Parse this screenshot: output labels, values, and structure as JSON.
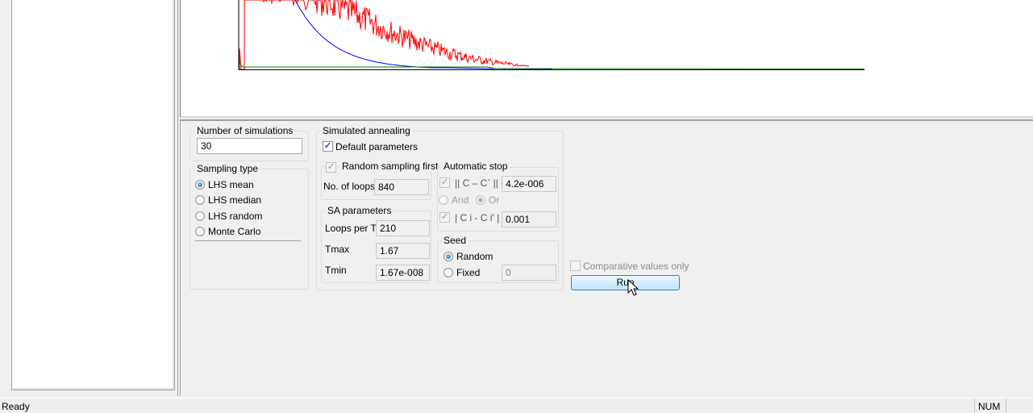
{
  "number_of_simulations": {
    "label": "Number of simulations",
    "value": "30"
  },
  "sampling_type": {
    "label": "Sampling type",
    "options": [
      {
        "label": "LHS mean",
        "selected": true
      },
      {
        "label": "LHS median",
        "selected": false
      },
      {
        "label": "LHS random",
        "selected": false
      },
      {
        "label": "Monte Carlo",
        "selected": false
      }
    ]
  },
  "simulated_annealing": {
    "label": "Simulated annealing",
    "default_parameters": {
      "label": "Default parameters",
      "checked": true
    },
    "random_sampling": {
      "label": "Random sampling first",
      "checked": true,
      "enabled": false,
      "loops_label": "No. of loops",
      "loops_value": "840"
    },
    "sa_parameters": {
      "label": "SA parameters",
      "loops_per_t_label": "Loops per T",
      "loops_per_t": "210",
      "tmax_label": "Tmax",
      "tmax": "1.67",
      "tmin_label": "Tmin",
      "tmin": "1.67e-008"
    },
    "automatic_stop": {
      "label": "Automatic stop",
      "c1_label": "|| C – C` || <",
      "c1_value": "4.2e-006",
      "and_label": "And",
      "or_label": "Or",
      "selected": "Or",
      "c2_label": "| C i - C i' | <",
      "c2_value": "0.001"
    },
    "seed": {
      "label": "Seed",
      "random_label": "Random",
      "fixed_label": "Fixed",
      "selected": "Random",
      "fixed_value": "0"
    }
  },
  "comparative": {
    "label": "Comparative values only",
    "checked": false
  },
  "run_label": "Run",
  "status": {
    "text": "Ready",
    "num": "NUM"
  },
  "colors": {
    "series_red": "#ff0000",
    "series_blue": "#0000ff",
    "series_green": "#008000",
    "run_border": "#3c7fb1"
  }
}
